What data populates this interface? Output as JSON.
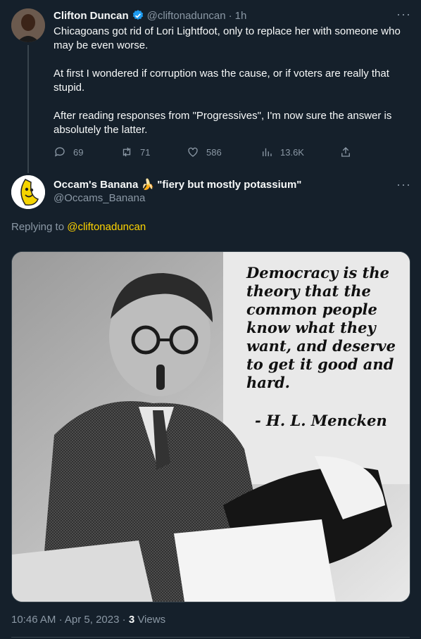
{
  "tweet1": {
    "author_name": "Clifton Duncan",
    "handle": "@cliftonaduncan",
    "separator": "·",
    "time": "1h",
    "paragraphs": [
      "Chicagoans got rid of Lori Lightfoot, only to replace her with someone who may be even worse.",
      "At first I wondered if corruption was the cause, or if voters are really that stupid.",
      "After reading responses from \"Progressives\", I'm now sure the answer is absolutely the latter."
    ],
    "replies": "69",
    "retweets": "71",
    "likes": "586",
    "views": "13.6K",
    "more": "···"
  },
  "tweet2": {
    "author_name": "Occam's Banana 🍌 \"fiery but mostly potassium\"",
    "handle": "@Occams_Banana",
    "more": "···",
    "replying_prefix": "Replying to",
    "replying_handle": "@cliftonaduncan",
    "image_quote": [
      "Democracy is the",
      "theory that the",
      "common people",
      "know what they",
      "want, and deserve",
      "to get it good and",
      "hard."
    ],
    "image_attribution": "- H. L. Mencken",
    "time": "10:46 AM",
    "sep1": "·",
    "date": "Apr 5, 2023",
    "sep2": "·",
    "views_count": "3",
    "views_label": "Views"
  },
  "colors": {
    "background": "#15202b",
    "muted": "#8b98a5",
    "link": "#ffd400",
    "verified": "#1d9bf0"
  }
}
